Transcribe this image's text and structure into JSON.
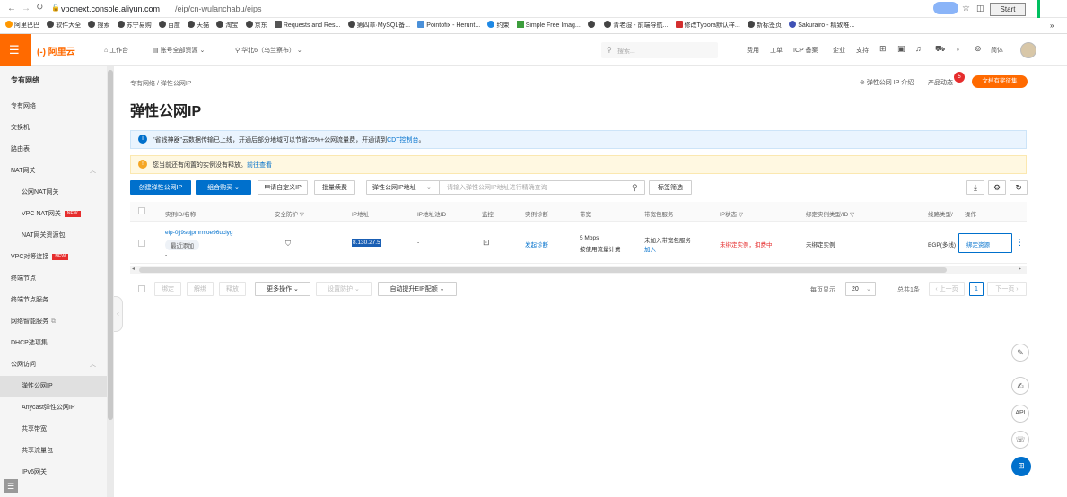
{
  "browser": {
    "url_host": "vpcnext.console.aliyun.com",
    "url_path": "/eip/cn-wulanchabu/eips",
    "start_button": "Start",
    "bookmarks": [
      "阿里巴巴",
      "软件大全",
      "搜索",
      "苏宁易购",
      "百度",
      "天猫",
      "淘宝",
      "京东",
      "Requests and Res...",
      "第四章·MySQL备...",
      "Pointofix - Herunt...",
      "约束",
      "Simple Free Imag...",
      "",
      "青老湿 - 前端导航...",
      "修改Typora默认样...",
      "新标签页",
      "Sakurairo - 精致唯..."
    ]
  },
  "topnav": {
    "logo": "(-) 阿里云",
    "workbench": "工作台",
    "account_resources": "账号全部资源",
    "region": "华北6（乌兰察布）",
    "search_placeholder": "搜索...",
    "links": [
      "费用",
      "工单",
      "ICP 备案",
      "企业",
      "支持"
    ],
    "language": "简体"
  },
  "sidebar": {
    "title": "专有网络",
    "items": [
      {
        "label": "专有网络",
        "sub": false
      },
      {
        "label": "交换机",
        "sub": false
      },
      {
        "label": "路由表",
        "sub": false
      },
      {
        "label": "NAT网关",
        "sub": false
      },
      {
        "label": "公网NAT网关",
        "sub": true
      },
      {
        "label": "VPC NAT网关",
        "sub": true,
        "tag": "NEW"
      },
      {
        "label": "NAT网关资源包",
        "sub": true
      },
      {
        "label": "VPC对等连接",
        "sub": false,
        "tag": "NEW"
      },
      {
        "label": "终端节点",
        "sub": false
      },
      {
        "label": "终端节点服务",
        "sub": false
      },
      {
        "label": "网络智能服务",
        "sub": false
      },
      {
        "label": "DHCP选项集",
        "sub": false
      },
      {
        "label": "公网访问",
        "sub": false
      },
      {
        "label": "弹性公网IP",
        "sub": true,
        "active": true
      },
      {
        "label": "Anycast弹性公网IP",
        "sub": true
      },
      {
        "label": "共享带宽",
        "sub": true
      },
      {
        "label": "共享流量包",
        "sub": true
      },
      {
        "label": "IPv6网关",
        "sub": true
      }
    ]
  },
  "main": {
    "breadcrumb": "专有网络 / 弹性公网IP",
    "page_title": "弹性公网IP",
    "top_right": {
      "intro": "弹性公网 IP 介绍",
      "news": "产品动态",
      "news_badge": "5",
      "promo": "文档有奖征集"
    },
    "info_banner": {
      "text": "\"省钱神器\"云数据传输已上线，开通后部分地域可以节省25%+公网流量费，开通请到",
      "link": "CDT控制台",
      "suffix": "。"
    },
    "warn_banner": {
      "text": "您当前还有闲置的实例没有释放。",
      "link": "前往查看"
    },
    "toolbar": {
      "create": "创建弹性公网IP",
      "combo": "组合购买",
      "apply_custom": "申请自定义IP",
      "bulk": "批量续费",
      "filter_field": "弹性公网IP地址",
      "search_placeholder": "请输入弹性公网IP地址进行精确查询",
      "tag_filter": "标签筛选"
    },
    "table": {
      "headers": [
        "实例ID/名称",
        "安全防护",
        "IP地址",
        "IP地址池ID",
        "监控",
        "实例诊断",
        "带宽",
        "带宽包服务",
        "IP状态",
        "绑定实例类型/ID",
        "线路类型/",
        "操作"
      ],
      "row": {
        "id": "eip-0jj9sujpmrmoe96uciyg",
        "tag": "最近添加",
        "name": "-",
        "ip": "8.130.27.5",
        "pool": "-",
        "diagnose": "发起诊断",
        "bandwidth": "5 Mbps",
        "billing": "按使用流量计费",
        "pkg_status": "未加入带宽包服务",
        "pkg_join": "加入",
        "ip_state": "未绑定实例，扣费中",
        "bound": "未绑定实例",
        "line": "BGP(多线)",
        "action": "绑定资源"
      }
    },
    "footer": {
      "buttons": [
        "绑定",
        "解绑",
        "释放"
      ],
      "more_ops": "更多操作",
      "set_protect": "设置防护",
      "auto_upgrade": "自动提升EIP配额",
      "per_page_label": "每页显示",
      "per_page": "20",
      "total": "总共1条",
      "prev": "上一页",
      "page": "1",
      "next": "下一页"
    }
  },
  "colors": {
    "accent": "#0070cc",
    "brand": "#ff6a00",
    "danger": "#e62d2d",
    "info_bg": "#eaf4fe",
    "warn_bg": "#fff8e1"
  }
}
